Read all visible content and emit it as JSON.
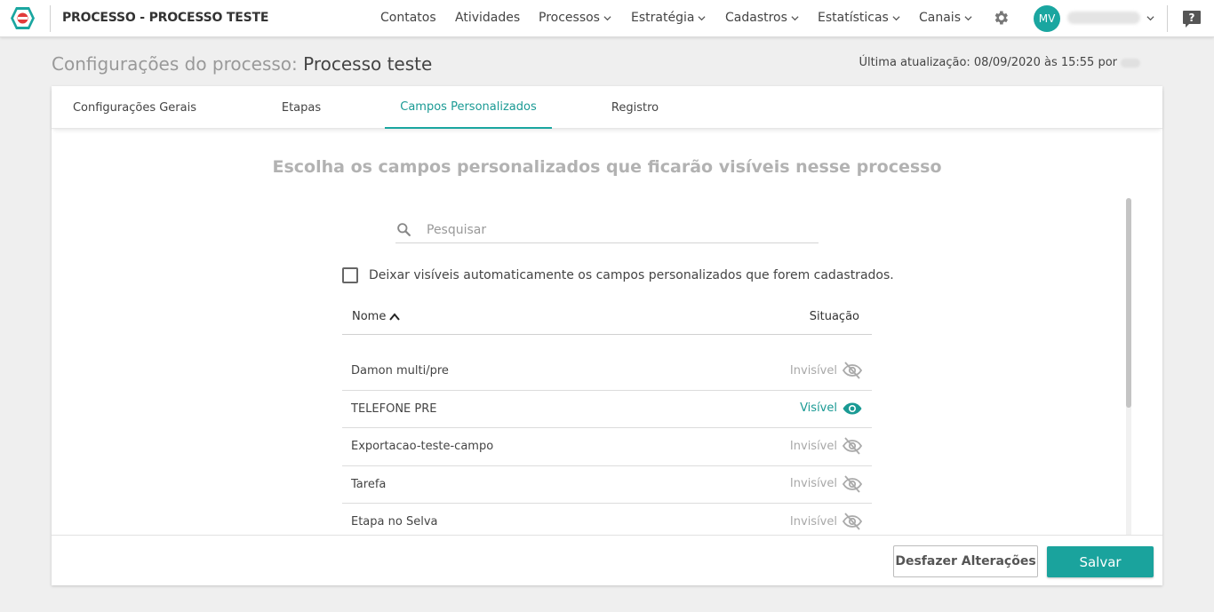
{
  "app": {
    "title": "PROCESSO - PROCESSO TESTE",
    "logo_icon": "red-circle-logo-icon",
    "brand_color": "#1aa6a0"
  },
  "nav": {
    "items": [
      {
        "label": "Contatos",
        "has_dropdown": false
      },
      {
        "label": "Atividades",
        "has_dropdown": false
      },
      {
        "label": "Processos",
        "has_dropdown": true
      },
      {
        "label": "Estratégia",
        "has_dropdown": true
      },
      {
        "label": "Cadastros",
        "has_dropdown": true
      },
      {
        "label": "Estatísticas",
        "has_dropdown": true
      },
      {
        "label": "Canais",
        "has_dropdown": true
      }
    ],
    "settings_icon": "gear-icon",
    "avatar_initials": "MV",
    "help_icon": "help-chat-icon"
  },
  "page": {
    "title_prefix": "Configurações do processo:",
    "title_name": "Processo teste",
    "last_update": "Última atualização: 08/09/2020 às 15:55 por"
  },
  "tabs": [
    {
      "label": "Configurações Gerais",
      "active": false
    },
    {
      "label": "Etapas",
      "active": false
    },
    {
      "label": "Campos Personalizados",
      "active": true
    },
    {
      "label": "Registro",
      "active": false
    }
  ],
  "content": {
    "heading": "Escolha os campos personalizados que ficarão visíveis nesse processo",
    "search_placeholder": "Pesquisar",
    "search_value": "",
    "auto_visible_label": "Deixar visíveis automaticamente os campos personalizados que forem cadastrados.",
    "auto_visible_checked": false,
    "columns": {
      "name": "Nome",
      "status": "Situação"
    },
    "sort": "asc",
    "rows": [
      {
        "name": "Damon multi/pre",
        "status": "Invisível",
        "visible": false
      },
      {
        "name": "TELEFONE PRE",
        "status": "Visível",
        "visible": true
      },
      {
        "name": "Exportacao-teste-campo",
        "status": "Invisível",
        "visible": false
      },
      {
        "name": "Tarefa",
        "status": "Invisível",
        "visible": false
      },
      {
        "name": "Etapa no Selva",
        "status": "Invisível",
        "visible": false
      }
    ]
  },
  "footer": {
    "undo_label": "Desfazer Alterações",
    "save_label": "Salvar"
  }
}
